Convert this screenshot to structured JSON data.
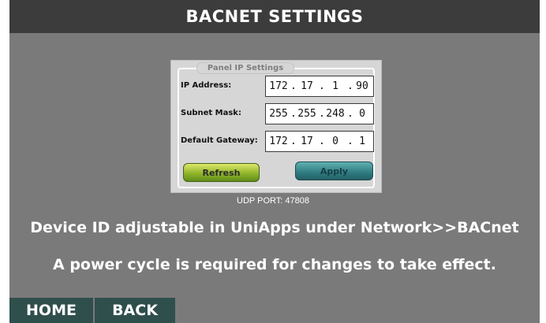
{
  "header": {
    "title": "BACNET SETTINGS"
  },
  "panel": {
    "legend": "Panel IP Settings",
    "fields": [
      {
        "label": "IP Address:",
        "octets": [
          "172",
          "17",
          "1",
          "90"
        ]
      },
      {
        "label": "Subnet Mask:",
        "octets": [
          "255",
          "255",
          "248",
          "0"
        ]
      },
      {
        "label": "Default Gateway:",
        "octets": [
          "172",
          "17",
          "0",
          "1"
        ]
      }
    ],
    "refresh_label": "Refresh",
    "apply_label": "Apply"
  },
  "udp_port": "UDP PORT: 47808",
  "messages": {
    "device_id": "Device ID adjustable in UniApps under Network>>BACnet",
    "power_cycle": "A power cycle is required for changes to take effect."
  },
  "footer": {
    "home_label": "HOME",
    "back_label": "BACK"
  }
}
